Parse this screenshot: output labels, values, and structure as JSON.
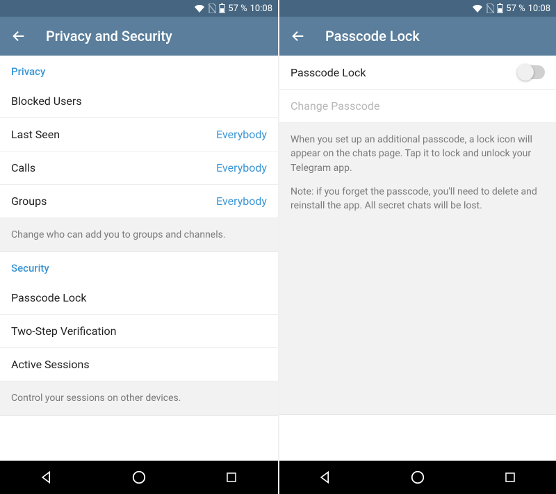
{
  "status": {
    "battery_pct": "57 %",
    "time": "10:08"
  },
  "left": {
    "header_title": "Privacy and Security",
    "section_privacy": "Privacy",
    "blocked_users": "Blocked Users",
    "last_seen_label": "Last Seen",
    "last_seen_value": "Everybody",
    "calls_label": "Calls",
    "calls_value": "Everybody",
    "groups_label": "Groups",
    "groups_value": "Everybody",
    "groups_helper": "Change who can add you to groups and channels.",
    "section_security": "Security",
    "passcode_lock": "Passcode Lock",
    "two_step": "Two-Step Verification",
    "active_sessions": "Active Sessions",
    "sessions_helper": "Control your sessions on other devices."
  },
  "right": {
    "header_title": "Passcode Lock",
    "passcode_lock_label": "Passcode Lock",
    "change_passcode": "Change Passcode",
    "helper_p1": "When you set up an additional passcode, a lock icon will appear on the chats page. Tap it to lock and unlock your Telegram app.",
    "helper_p2": "Note: if you forget the passcode, you'll need to delete and reinstall the app. All secret chats will be lost."
  }
}
